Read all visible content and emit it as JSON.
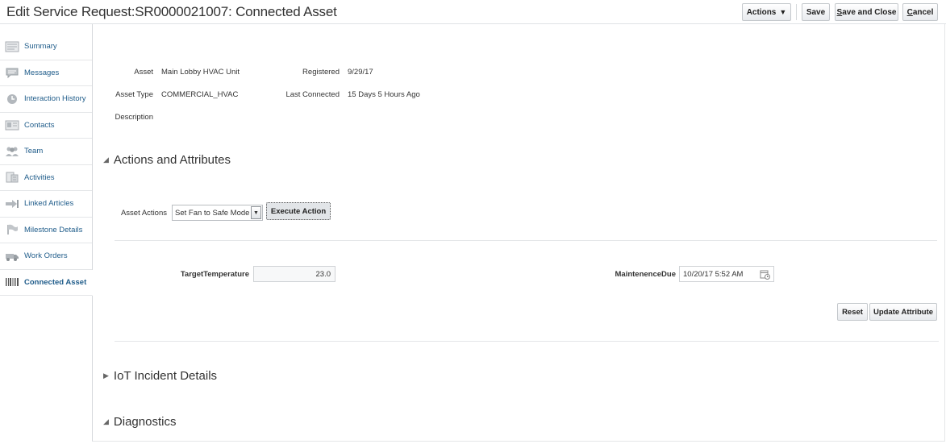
{
  "page_title": "Edit Service Request:SR0000021007: Connected Asset",
  "header": {
    "actions_label": "Actions",
    "save_label": "Save",
    "save_close_label_u": "S",
    "save_close_label_rest": "ave and Close",
    "cancel_label_u": "C",
    "cancel_label_rest": "ancel"
  },
  "sidebar": {
    "items": [
      {
        "label": "Summary",
        "icon": "summary-icon"
      },
      {
        "label": "Messages",
        "icon": "messages-icon"
      },
      {
        "label": "Interaction History",
        "icon": "interaction-history-icon"
      },
      {
        "label": "Contacts",
        "icon": "contacts-icon"
      },
      {
        "label": "Team",
        "icon": "team-icon"
      },
      {
        "label": "Activities",
        "icon": "activities-icon"
      },
      {
        "label": "Linked Articles",
        "icon": "linked-articles-icon"
      },
      {
        "label": "Milestone Details",
        "icon": "milestone-icon"
      },
      {
        "label": "Work Orders",
        "icon": "work-orders-icon"
      },
      {
        "label": "Connected Asset",
        "icon": "barcode-icon",
        "active": true
      }
    ]
  },
  "asset": {
    "asset_label": "Asset",
    "asset_value": "Main Lobby HVAC Unit",
    "registered_label": "Registered",
    "registered_value": "9/29/17",
    "asset_type_label": "Asset Type",
    "asset_type_value": "COMMERCIAL_HVAC",
    "last_connected_label": "Last Connected",
    "last_connected_value": "15 Days 5 Hours Ago",
    "description_label": "Description"
  },
  "actions_attributes": {
    "title": "Actions and Attributes",
    "asset_actions_label": "Asset Actions",
    "asset_actions_selected": "Set Fan to Safe Mode",
    "execute_label": "Execute Action",
    "target_temp_label": "TargetTemperature",
    "target_temp_value": "23.0",
    "maintenance_due_label": "MaintenenceDue",
    "maintenance_due_value": "10/20/17 5:52 AM",
    "reset_label": "Reset",
    "update_label": "Update Attribute"
  },
  "iot_incident": {
    "title": "IoT Incident Details"
  },
  "diagnostics": {
    "title": "Diagnostics"
  }
}
